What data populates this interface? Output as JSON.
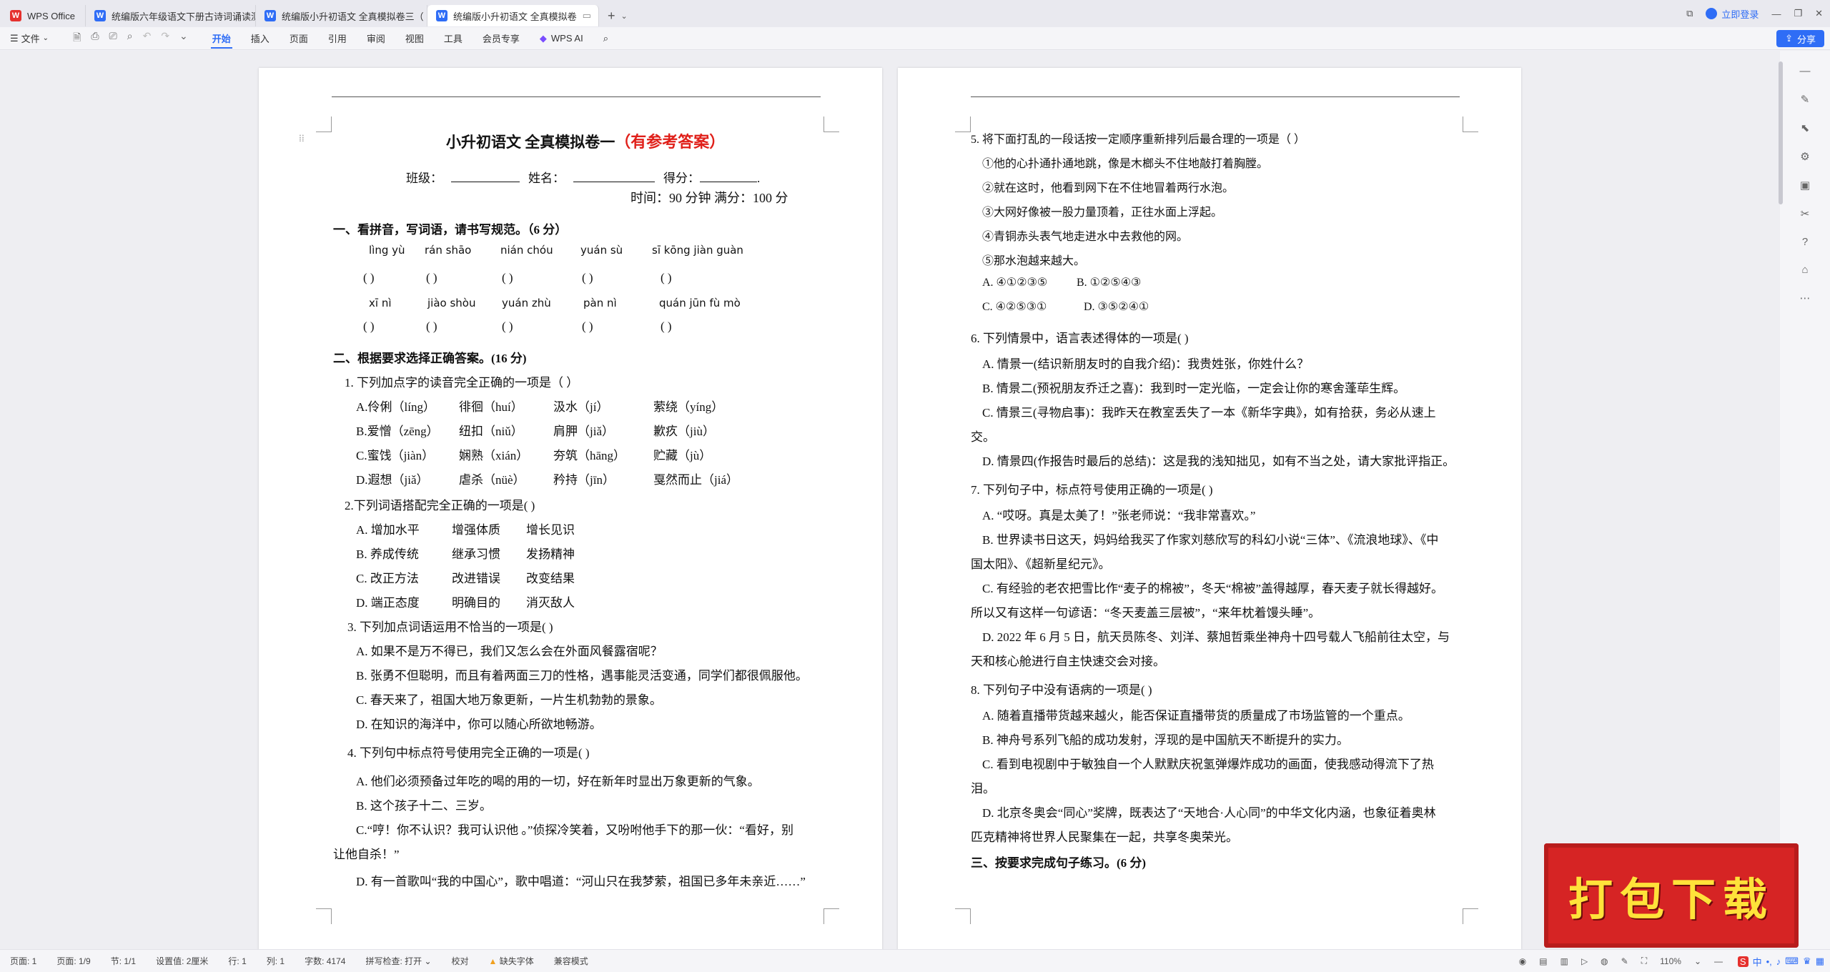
{
  "tabs": [
    {
      "label": "WPS Office",
      "icon": "wps-logo-icon"
    },
    {
      "label": "统编版六年级语文下册古诗词诵读测",
      "icon": "word-doc-icon"
    },
    {
      "label": "统编版小升初语文 全真模拟卷三（",
      "icon": "word-doc-icon"
    },
    {
      "label": "统编版小升初语文 全真模拟卷",
      "icon": "word-doc-icon"
    }
  ],
  "titlebar": {
    "login": "立即登录",
    "share": "分享"
  },
  "ribbon": {
    "file": "文件",
    "items": [
      "开始",
      "插入",
      "页面",
      "引用",
      "审阅",
      "视图",
      "工具",
      "会员专享"
    ],
    "ai": "WPS AI"
  },
  "page1": {
    "title": "小升初语文  全真模拟卷一",
    "title_red": "（有参考答案）",
    "info_class": "班级：",
    "info_name": "姓名：",
    "info_score": "得分：",
    "info_time": "时间：90 分钟    满分：100 分",
    "q1": "一、看拼音，写词语，请书写规范。（6 分）",
    "pinyin_row1": [
      "lìng yù",
      "rán shāo",
      "nián chóu",
      "yuán sù",
      "sī kōng jiàn guàn"
    ],
    "pinyin_row2": [
      "xī nì",
      "jiào shòu",
      "yuán zhù",
      "pàn nì",
      "quán jūn fù mò"
    ],
    "paren": "(          )",
    "paren_long": "(                    )",
    "q2": "二、根据要求选择正确答案。(16 分)",
    "q2_1": "1. 下列加点字的读音完全正确的一项是（      ）",
    "q2_1_opts": [
      [
        "A.伶俐（líng）",
        "徘徊（huí）",
        "汲水（jí）",
        "萦绕（yíng）"
      ],
      [
        "B.爱憎（zēng）",
        "纽扣（niǔ）",
        "肩胛（jiǎ）",
        "歉疚（jiù）"
      ],
      [
        "C.蜜饯（jiàn）",
        "娴熟（xián）",
        "夯筑（hāng）",
        "贮藏（jù）"
      ],
      [
        "D.遐想（jiǎ）",
        "虐杀（nüè）",
        "矜持（jīn）",
        "戛然而止（jiá）"
      ]
    ],
    "q2_2": "2.下列词语搭配完全正确的一项是(        )",
    "q2_2_opts": [
      [
        "A.  增加水平",
        "增强体质",
        "增长见识"
      ],
      [
        "B.  养成传统",
        "继承习惯",
        "发扬精神"
      ],
      [
        "C.  改正方法",
        "改进错误",
        "改变结果"
      ],
      [
        "D.  端正态度",
        "明确目的",
        "消灭敌人"
      ]
    ],
    "q2_3": "3.  下列加点词语运用不恰当的一项是(         )",
    "q2_3_opts": [
      "A.  如果不是万不得已，我们又怎么会在外面风餐露宿呢？",
      "B.  张勇不但聪明，而且有着两面三刀的性格，遇事能灵活变通，同学们都很佩服他。",
      "C.  春天来了，祖国大地万象更新，一片生机勃勃的景象。",
      "D.  在知识的海洋中，你可以随心所欲地畅游。"
    ],
    "q2_4": "4.  下列句中标点符号使用完全正确的一项是(         )",
    "q2_4_opts": [
      "A.  他们必须预备过年吃的喝的用的一切，好在新年时显出万象更新的气象。",
      "B.  这个孩子十二、三岁。",
      "C.“哼！你不认识？我可认识他 。”侦探冷笑着，又吩咐他手下的那一伙：“看好，别",
      "让他自杀！”",
      "D.  有一首歌叫“我的中国心”，歌中唱道：“河山只在我梦萦，祖国已多年未亲近……”"
    ]
  },
  "page2": {
    "q5": "5. 将下面打乱的一段话按一定顺序重新排列后最合理的一项是（          ）",
    "q5_items": [
      "①他的心扑通扑通地跳，像是木榔头不住地敲打着胸膛。",
      "②就在这时，他看到网下在不住地冒着两行水泡。",
      "③大网好像被一股力量顶着，正往水面上浮起。",
      "④青铜赤头表气地走进水中去救他的网。",
      "⑤那水泡越来越大。"
    ],
    "q5_opts": [
      [
        "A. ④①②③⑤",
        "B. ①②⑤④③"
      ],
      [
        "C. ④②⑤③①",
        "D. ③⑤②④①"
      ]
    ],
    "q6": "6.  下列情景中，语言表述得体的一项是(        )",
    "q6_opts": [
      "A.  情景一(结识新朋友时的自我介绍)：我贵姓张，你姓什么？",
      "B.  情景二(预祝朋友乔迁之喜)：我到时一定光临，一定会让你的寒舍蓬荜生辉。",
      "C.  情景三(寻物启事)：我昨天在教室丢失了一本《新华字典》，如有拾获，务必从速上",
      "交。",
      "D.  情景四(作报告时最后的总结)：这是我的浅知拙见，如有不当之处，请大家批评指正。"
    ],
    "q7": "7.  下列句子中，标点符号使用正确的一项是(         )",
    "q7_opts": [
      "A. “哎呀。真是太美了！”张老师说：“我非常喜欢。”",
      "B.  世界读书日这天，妈妈给我买了作家刘慈欣写的科幻小说“三体”、《流浪地球》、《中",
      "国太阳》、《超新星纪元》。",
      "C.  有经验的老农把雪比作“麦子的棉被”，冬天“棉被”盖得越厚，春天麦子就长得越好。",
      "所以又有这样一句谚语：“冬天麦盖三层被”，“来年枕着馒头睡”。",
      "D. 2022 年 6 月 5 日，航天员陈冬、刘洋、蔡旭哲乘坐神舟十四号载人飞船前往太空，与",
      "天和核心舱进行自主快速交会对接。"
    ],
    "q8": "8.  下列句子中没有语病的一项是(        )",
    "q8_opts": [
      "A.  随着直播带货越来越火，能否保证直播带货的质量成了市场监管的一个重点。",
      "B.  神舟号系列飞船的成功发射，浮现的是中国航天不断提升的实力。",
      "C.  看到电视剧中于敏独自一个人默默庆祝氢弹爆炸成功的画面，使我感动得流下了热",
      "泪。",
      "D.  北京冬奥会“同心”奖牌，既表达了“天地合·人心同”的中华文化内涵，也象征着奥林",
      "匹克精神将世界人民聚集在一起，共享冬奥荣光。"
    ],
    "q9": "三、按要求完成句子练习。(6 分)"
  },
  "status": {
    "page": "页面: 1",
    "pages": "页面: 1/9",
    "section": "节: 1/1",
    "setting": "设置值: 2厘米",
    "row": "行: 1",
    "col": "列: 1",
    "words": "字数: 4174",
    "spell": "拼写检查: 打开",
    "proof": "校对",
    "missing_font": "缺失字体",
    "compat": "兼容模式",
    "zoom": "110%"
  },
  "stamp": "打包下载",
  "colors": {
    "accent": "#2f6df6",
    "title_red": "#e0201a",
    "stamp_red": "#d62424",
    "stamp_text": "#ffe23a"
  }
}
